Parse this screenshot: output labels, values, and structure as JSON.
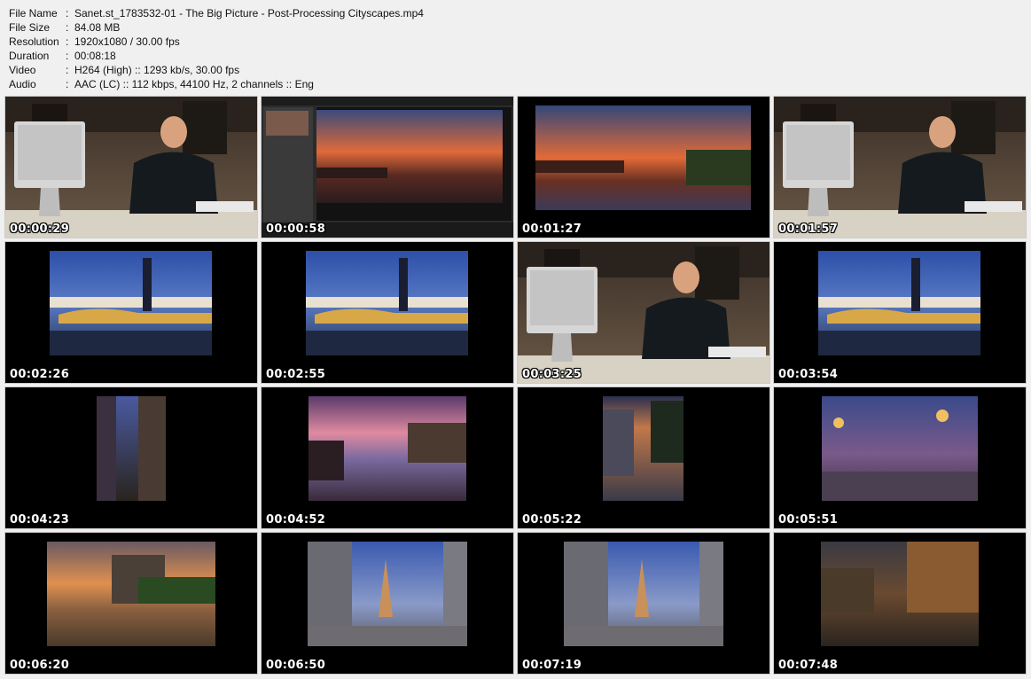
{
  "info": [
    {
      "key": "File Name",
      "value": "Sanet.st_1783532-01 - The Big Picture - Post-Processing Cityscapes.mp4"
    },
    {
      "key": "File Size",
      "value": "84.08 MB"
    },
    {
      "key": "Resolution",
      "value": "1920x1080 / 30.00 fps"
    },
    {
      "key": "Duration",
      "value": "00:08:18"
    },
    {
      "key": "Video",
      "value": "H264 (High) :: 1293 kb/s, 30.00 fps"
    },
    {
      "key": "Audio",
      "value": "AAC (LC) :: 112 kbps, 44100 Hz, 2 channels :: Eng"
    }
  ],
  "separator": ":",
  "thumbnails": [
    {
      "time": "00:00:29",
      "scene": "studio-presenter"
    },
    {
      "time": "00:00:58",
      "scene": "lightroom-paris-sunset"
    },
    {
      "time": "00:01:27",
      "scene": "paris-sunset"
    },
    {
      "time": "00:01:57",
      "scene": "studio-presenter"
    },
    {
      "time": "00:02:26",
      "scene": "paris-bridge-blue"
    },
    {
      "time": "00:02:55",
      "scene": "paris-bridge-blue"
    },
    {
      "time": "00:03:25",
      "scene": "studio-presenter"
    },
    {
      "time": "00:03:54",
      "scene": "paris-bridge-blue"
    },
    {
      "time": "00:04:23",
      "scene": "paris-alley"
    },
    {
      "time": "00:04:52",
      "scene": "notre-dame-river-pink"
    },
    {
      "time": "00:05:22",
      "scene": "paris-street-stairs"
    },
    {
      "time": "00:05:51",
      "scene": "paris-lamps-eiffel"
    },
    {
      "time": "00:06:20",
      "scene": "notre-dame-sunset"
    },
    {
      "time": "00:06:50",
      "scene": "eiffel-tower-street"
    },
    {
      "time": "00:07:19",
      "scene": "eiffel-tower-street"
    },
    {
      "time": "00:07:48",
      "scene": "arcade-street"
    }
  ]
}
